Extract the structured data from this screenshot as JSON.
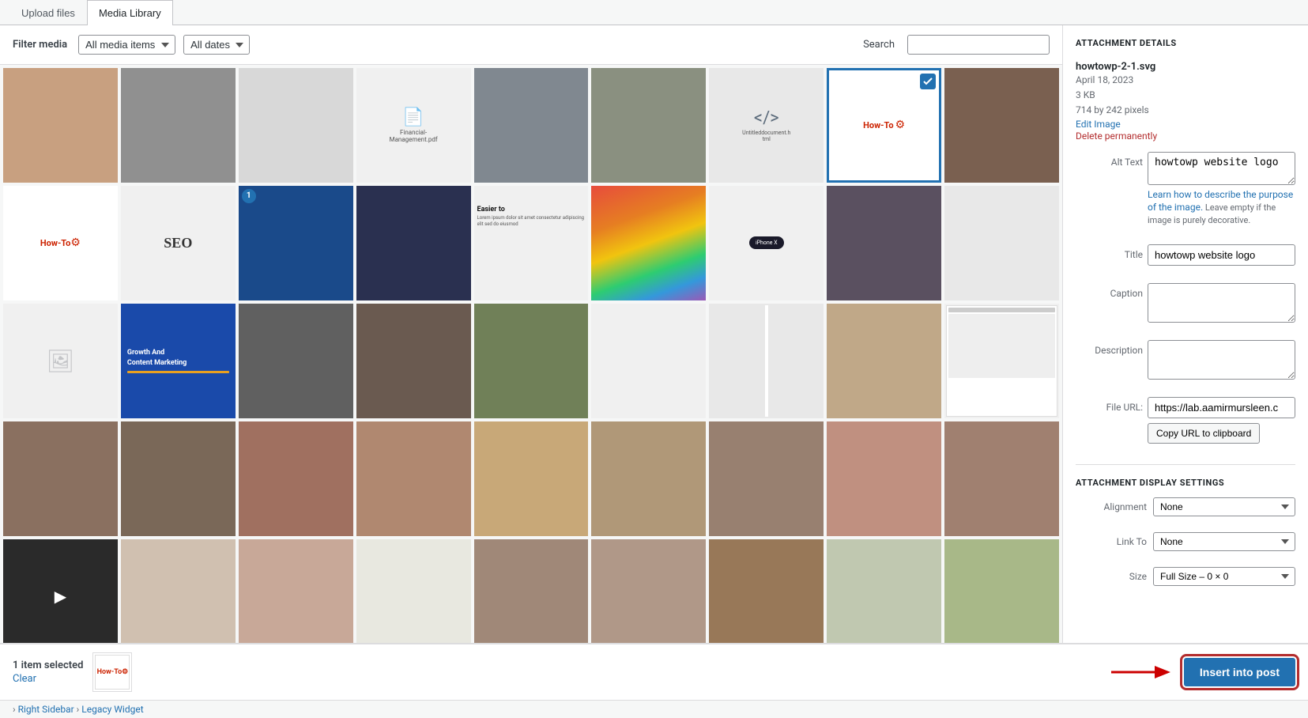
{
  "tabs": [
    {
      "id": "upload",
      "label": "Upload files",
      "active": false
    },
    {
      "id": "library",
      "label": "Media Library",
      "active": true
    }
  ],
  "filter": {
    "label": "Filter media",
    "media_items_label": "All media items",
    "dates_label": "All dates",
    "search_label": "Search"
  },
  "attachment_details": {
    "section_title": "ATTACHMENT DETAILS",
    "filename": "howtowp-2-1.svg",
    "date": "April 18, 2023",
    "size": "3 KB",
    "dimensions": "714 by 242 pixels",
    "edit_link": "Edit Image",
    "delete_link": "Delete permanently",
    "alt_text_label": "Alt Text",
    "alt_text_value": "howtowp website logo",
    "learn_how_link": "Learn how to describe the purpose of the image.",
    "learn_how_suffix": " Leave empty if the image is purely decorative.",
    "title_label": "Title",
    "title_value": "howtowp website logo",
    "caption_label": "Caption",
    "caption_value": "",
    "description_label": "Description",
    "description_value": "",
    "file_url_label": "File URL:",
    "file_url_value": "https://lab.aamirmursleen.c",
    "copy_btn": "Copy URL to clipboard"
  },
  "display_settings": {
    "section_title": "ATTACHMENT DISPLAY SETTINGS",
    "alignment_label": "Alignment",
    "alignment_value": "None",
    "link_to_label": "Link To",
    "link_to_value": "None",
    "size_label": "Size",
    "size_value": "Full Size – 0 × 0"
  },
  "footer": {
    "selected_count": "1 item selected",
    "clear_label": "Clear",
    "insert_label": "Insert into post"
  },
  "breadcrumb": {
    "items": [
      "Right Sidebar",
      "Legacy Widget"
    ]
  }
}
